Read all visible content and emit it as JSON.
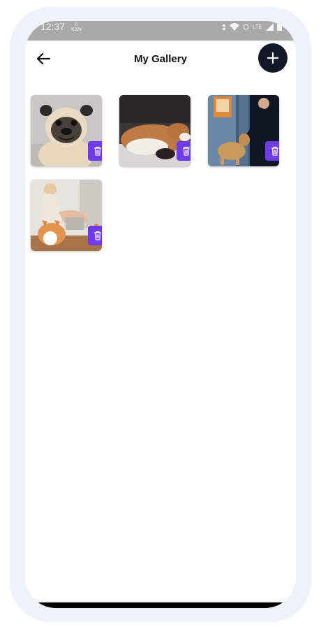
{
  "status_bar": {
    "time": "12:37",
    "speed_value": "0",
    "speed_unit": "KB/s",
    "network": "LTE"
  },
  "header": {
    "title": "My Gallery",
    "back_icon": "arrow-left-icon",
    "add_icon": "plus-icon"
  },
  "gallery": {
    "photos": [
      {
        "subject": "pug"
      },
      {
        "subject": "dog lying down"
      },
      {
        "subject": "dog with person"
      },
      {
        "subject": "woman with corgi"
      }
    ],
    "delete_icon": "trash-icon"
  },
  "colors": {
    "accent": "#6f3ae8",
    "add_button": "#111827",
    "status_bar": "#a9a9a9"
  }
}
